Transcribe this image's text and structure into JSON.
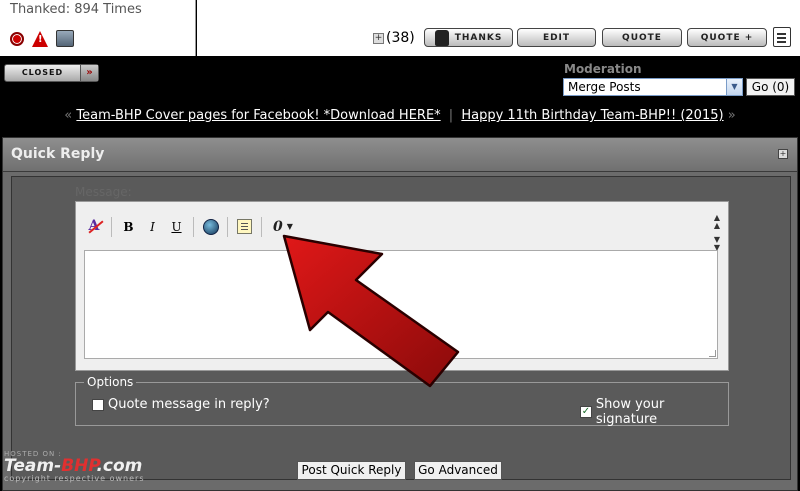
{
  "post": {
    "thanked_text": "Thanked: 894 Times",
    "thanks_count": "(38)",
    "buttons": {
      "thanks": "THANKS",
      "edit": "EDIT",
      "quote": "QUOTE",
      "multiquote": "QUOTE +"
    }
  },
  "thread": {
    "closed_label": "CLOSED",
    "closed_arrow": "»"
  },
  "moderation": {
    "label": "Moderation",
    "selected": "Merge Posts",
    "go_label": "Go (0)"
  },
  "links": {
    "prev_quote": "«",
    "link1": "Team-BHP Cover pages for Facebook! *Download HERE*",
    "separator": "|",
    "link2": "Happy 11th Birthday Team-BHP!! (2015)",
    "next_quote": "»"
  },
  "quick_reply": {
    "title": "Quick Reply",
    "message_label": "Message:",
    "toolbar": {
      "bold": "B",
      "italic": "I",
      "underline": "U",
      "attach": "0"
    },
    "options_legend": "Options",
    "quote_option": "Quote message in reply?",
    "signature_option": "Show your signature",
    "signature_checked": true,
    "quote_checked": false,
    "post_button": "Post Quick Reply",
    "advanced_button": "Go Advanced"
  },
  "watermark": {
    "hosted": "HOSTED ON :",
    "logo_a": "Team-",
    "logo_b": "BHP",
    "logo_c": ".com",
    "copyright": "copyright respective owners"
  },
  "colors": {
    "panel": "#6b6b6b",
    "arrow": "#c41414",
    "link": "#ffffff"
  }
}
